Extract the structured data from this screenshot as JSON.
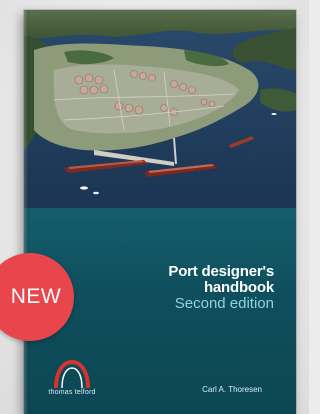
{
  "book": {
    "title_line1": "Port designer's",
    "title_line2": "handbook",
    "edition": "Second edition",
    "author": "Carl A. Thoresen",
    "publisher": "thomas telford"
  },
  "badge": {
    "label": "NEW"
  },
  "cover_photo": {
    "subject": "aerial-port-photo"
  },
  "colors": {
    "cover_teal": "#0f4e5c",
    "badge_red": "#e8464c",
    "edition_blue": "#8fd2e0",
    "logo_red": "#d8322f"
  }
}
